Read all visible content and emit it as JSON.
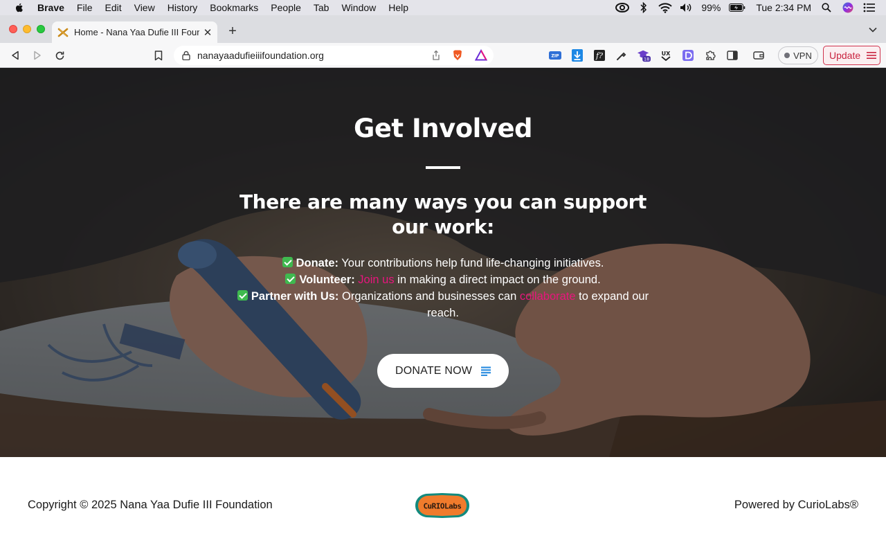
{
  "menubar": {
    "app_name": "Brave",
    "items": [
      "File",
      "Edit",
      "View",
      "History",
      "Bookmarks",
      "People",
      "Tab",
      "Window",
      "Help"
    ],
    "battery": "99%",
    "clock": "Tue 2:34 PM"
  },
  "browser": {
    "tab_title": "Home - Nana Yaa Dufie III Foundation",
    "url": "nanayaadufieiiifoundation.org",
    "vpn_label": "VPN",
    "update_label": "Update",
    "extension_badge": "18"
  },
  "hero": {
    "title": "Get Involved",
    "subtitle": "There are many ways you can support our work:",
    "ways": [
      {
        "label": "Donate:",
        "text_before": " Your contributions help fund life-changing initiatives.",
        "link": "",
        "text_after": ""
      },
      {
        "label": "Volunteer:",
        "text_before": " ",
        "link": "Join us",
        "text_after": " in making a direct impact on the ground."
      },
      {
        "label": "Partner with Us:",
        "text_before": " Organizations and businesses can ",
        "link": "collaborate",
        "text_after": " to expand our reach."
      }
    ],
    "donate_button": "DONATE NOW"
  },
  "footer": {
    "copyright": "Copyright © 2025 Nana Yaa Dufie III Foundation",
    "logo_text": "CURIOLABS",
    "powered_by": "Powered by CurioLabs®"
  },
  "colors": {
    "accent_link": "#e8157d",
    "check_green": "#3fb94f",
    "update_red": "#c9243f"
  }
}
